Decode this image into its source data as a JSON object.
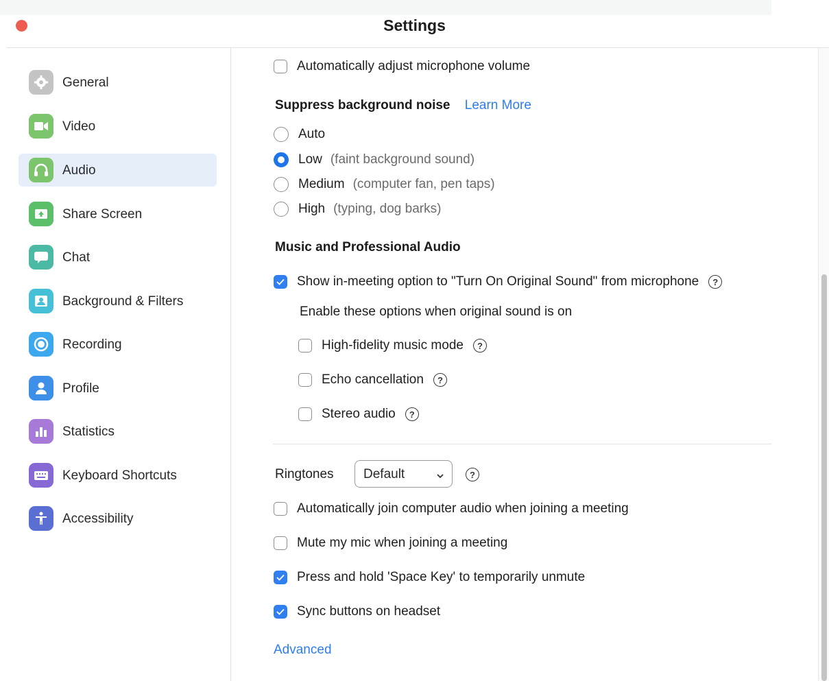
{
  "window": {
    "title": "Settings"
  },
  "sidebar": {
    "items": [
      {
        "label": "General",
        "icon": "gear-icon",
        "color": "#c4c4c4"
      },
      {
        "label": "Video",
        "icon": "video-camera-icon",
        "color": "#7cc56c"
      },
      {
        "label": "Audio",
        "icon": "headphones-icon",
        "color": "#7cc56c",
        "active": true
      },
      {
        "label": "Share Screen",
        "icon": "share-screen-icon",
        "color": "#5cbf6a"
      },
      {
        "label": "Chat",
        "icon": "chat-bubble-icon",
        "color": "#4cb9a5"
      },
      {
        "label": "Background & Filters",
        "icon": "person-portrait-icon",
        "color": "#46c0d6"
      },
      {
        "label": "Recording",
        "icon": "record-icon",
        "color": "#3ea8ef"
      },
      {
        "label": "Profile",
        "icon": "person-icon",
        "color": "#3d8fe8"
      },
      {
        "label": "Statistics",
        "icon": "bar-chart-icon",
        "color": "#a87ad8"
      },
      {
        "label": "Keyboard Shortcuts",
        "icon": "keyboard-icon",
        "color": "#8669d4"
      },
      {
        "label": "Accessibility",
        "icon": "accessibility-icon",
        "color": "#5b6fd2"
      }
    ]
  },
  "audio": {
    "auto_adjust_mic": {
      "label": "Automatically adjust microphone volume",
      "checked": false
    },
    "suppress_noise": {
      "heading": "Suppress background noise",
      "learn_more": "Learn More",
      "options": [
        {
          "label": "Auto",
          "hint": "",
          "selected": false
        },
        {
          "label": "Low",
          "hint": "(faint background sound)",
          "selected": true
        },
        {
          "label": "Medium",
          "hint": "(computer fan, pen taps)",
          "selected": false
        },
        {
          "label": "High",
          "hint": "(typing, dog barks)",
          "selected": false
        }
      ]
    },
    "music_pro": {
      "heading": "Music and Professional Audio",
      "original_sound": {
        "label": "Show in-meeting option to \"Turn On Original Sound\" from microphone",
        "checked": true
      },
      "sub_heading": "Enable these options when original sound is on",
      "sub_options": [
        {
          "label": "High-fidelity music mode",
          "checked": false
        },
        {
          "label": "Echo cancellation",
          "checked": false
        },
        {
          "label": "Stereo audio",
          "checked": false
        }
      ]
    },
    "ringtones": {
      "label": "Ringtones",
      "value": "Default"
    },
    "options": [
      {
        "label": "Automatically join computer audio when joining a meeting",
        "checked": false
      },
      {
        "label": "Mute my mic when joining a meeting",
        "checked": false
      },
      {
        "label": "Press and hold 'Space Key' to temporarily unmute",
        "checked": true
      },
      {
        "label": "Sync buttons on headset",
        "checked": true
      }
    ],
    "advanced_link": "Advanced"
  },
  "colors": {
    "accent": "#2f7ff0",
    "link": "#2d7df0",
    "close_button": "#ee5d52",
    "active_nav": "#e6eef9"
  }
}
